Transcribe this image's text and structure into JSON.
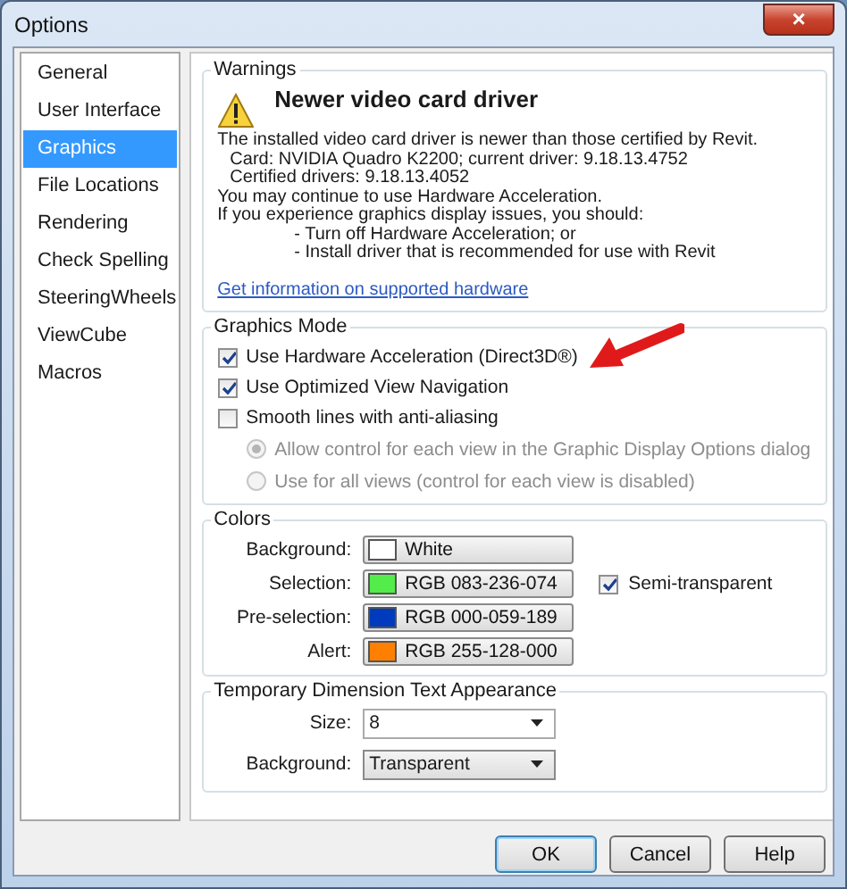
{
  "window": {
    "title": "Options",
    "close": "×"
  },
  "sidebar": {
    "items": [
      {
        "label": "General",
        "selected": false
      },
      {
        "label": "User Interface",
        "selected": false
      },
      {
        "label": "Graphics",
        "selected": true
      },
      {
        "label": "File Locations",
        "selected": false
      },
      {
        "label": "Rendering",
        "selected": false
      },
      {
        "label": "Check Spelling",
        "selected": false
      },
      {
        "label": "SteeringWheels",
        "selected": false
      },
      {
        "label": "ViewCube",
        "selected": false
      },
      {
        "label": "Macros",
        "selected": false
      }
    ]
  },
  "warnings": {
    "title": "Warnings",
    "heading": "Newer video card driver",
    "lines": [
      {
        "kind": "body",
        "text": "The installed video card driver is newer than those certified by Revit."
      },
      {
        "kind": "detail",
        "text": "Card: NVIDIA Quadro K2200; current driver: 9.18.13.4752"
      },
      {
        "kind": "detail",
        "text": "Certified drivers: 9.18.13.4052"
      },
      {
        "kind": "body",
        "text": "You may continue to use Hardware Acceleration."
      },
      {
        "kind": "body",
        "text": "If you experience graphics display issues, you should:"
      },
      {
        "kind": "bullet",
        "text": "- Turn off Hardware Acceleration; or"
      },
      {
        "kind": "bullet",
        "text": "- Install driver that is recommended for use with Revit"
      }
    ],
    "link": "Get information on supported hardware"
  },
  "graphics_mode": {
    "title": "Graphics Mode",
    "options": [
      {
        "kind": "checkbox",
        "label": "Use Hardware Acceleration (Direct3D®)",
        "checked": true
      },
      {
        "kind": "checkbox",
        "label": "Use Optimized View Navigation",
        "checked": true
      },
      {
        "kind": "checkbox",
        "label": "Smooth lines with anti-aliasing",
        "checked": false
      },
      {
        "kind": "radio",
        "label": "Allow control for each view in the Graphic Display Options dialog",
        "selected": true,
        "disabled": true
      },
      {
        "kind": "radio",
        "label": "Use for all views (control for each view is disabled)",
        "selected": false,
        "disabled": true
      }
    ]
  },
  "colors": {
    "title": "Colors",
    "rows": [
      {
        "label": "Background:",
        "color": "#ffffff",
        "value": "White"
      },
      {
        "label": "Selection:",
        "color": "#53ec4a",
        "value": "RGB 083-236-074",
        "option": {
          "label": "Semi-transparent",
          "checked": true
        }
      },
      {
        "label": "Pre-selection:",
        "color": "#003bbd",
        "value": "RGB 000-059-189"
      },
      {
        "label": "Alert:",
        "color": "#ff8000",
        "value": "RGB 255-128-000"
      }
    ]
  },
  "temporary_dimension": {
    "title": "Temporary Dimension Text Appearance",
    "fields": [
      {
        "label": "Size:",
        "value": "8",
        "kind": "editable"
      },
      {
        "label": "Background:",
        "value": "Transparent",
        "kind": "list"
      }
    ]
  },
  "buttons": [
    {
      "label": "OK",
      "default": true
    },
    {
      "label": "Cancel",
      "default": false
    },
    {
      "label": "Help",
      "default": false
    }
  ]
}
